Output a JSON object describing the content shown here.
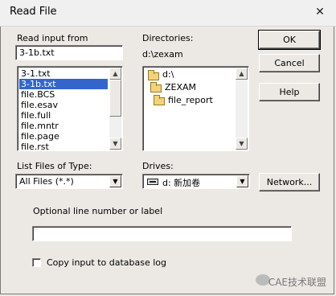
{
  "window": {
    "title": "Read File",
    "close_glyph": "✕"
  },
  "read_input": {
    "label": "Read input from",
    "value": "3-1b.txt",
    "files": [
      "3-1.txt",
      "3-1b.txt",
      "file.BCS",
      "file.esav",
      "file.full",
      "file.mntr",
      "file.page",
      "file.rst"
    ],
    "selected_index": 1
  },
  "directories": {
    "label": "Directories:",
    "current_path": "d:\\zexam",
    "items": [
      {
        "name": "d:\\",
        "icon": "open-folder-icon",
        "level": 0
      },
      {
        "name": "ZEXAM",
        "icon": "open-folder-icon",
        "level": 1
      },
      {
        "name": "file_report",
        "icon": "folder-icon",
        "level": 2
      }
    ]
  },
  "buttons": {
    "ok": "OK",
    "cancel": "Cancel",
    "help": "Help",
    "network": "Network..."
  },
  "file_type": {
    "label": "List Files of Type:",
    "value": "All Files (*.*)"
  },
  "drives": {
    "label": "Drives:",
    "value": "d: 新加卷"
  },
  "optional": {
    "label": "Optional line number or label",
    "value": ""
  },
  "copy_input": {
    "label": "Copy input to database log",
    "checked": false
  },
  "watermark": {
    "text": "CAE技术联盟"
  },
  "colors": {
    "selection": "#3366cc",
    "dialog_bg": "#ece9e4"
  }
}
